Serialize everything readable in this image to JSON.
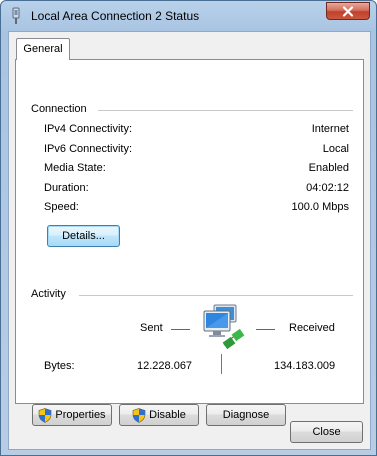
{
  "window": {
    "title": "Local Area Connection 2 Status"
  },
  "tabs": [
    {
      "label": "General"
    }
  ],
  "connection": {
    "group_label": "Connection",
    "rows": [
      {
        "label": "IPv4 Connectivity:",
        "value": "Internet"
      },
      {
        "label": "IPv6 Connectivity:",
        "value": "Local"
      },
      {
        "label": "Media State:",
        "value": "Enabled"
      },
      {
        "label": "Duration:",
        "value": "04:02:12"
      },
      {
        "label": "Speed:",
        "value": "100.0 Mbps"
      }
    ],
    "details_button": "Details..."
  },
  "activity": {
    "group_label": "Activity",
    "sent_label": "Sent",
    "received_label": "Received",
    "bytes_label": "Bytes:",
    "bytes_sent": "12.228.067",
    "bytes_received": "134.183.009",
    "icon": "network-computers-icon"
  },
  "buttons": {
    "properties": "Properties",
    "disable": "Disable",
    "diagnose": "Diagnose",
    "close": "Close"
  },
  "icons": {
    "title": "network-adapter-icon",
    "window_close": "close-icon",
    "shield": "uac-shield-icon"
  },
  "colors": {
    "titlebar": "#b9d1ea",
    "close_button": "#c9583f",
    "client_background": "#f0f0f0",
    "panel_background": "#ffffff",
    "default_button_border": "#3c7fb1"
  }
}
